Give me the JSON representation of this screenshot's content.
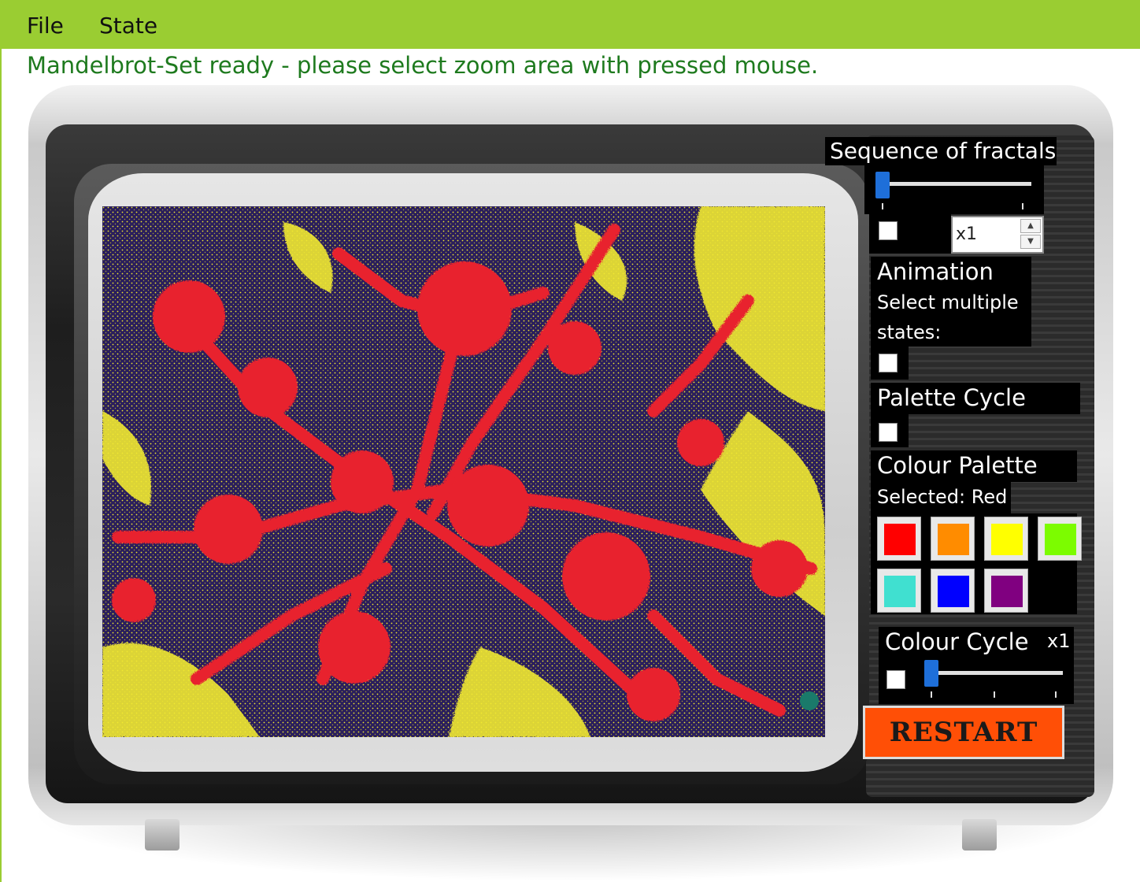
{
  "menu": {
    "file": "File",
    "state": "State"
  },
  "status_text": "Mandelbrot-Set ready - please select zoom area with pressed mouse.",
  "sequence": {
    "title": "Sequence of fractals",
    "slider_value": 0,
    "multiplier": "x1",
    "checked": false
  },
  "spin_icons": {
    "up": "up-arrow-icon",
    "down": "down-arrow-icon"
  },
  "animation": {
    "title": "Animation",
    "line1": "Select multiple",
    "line2": "states:",
    "checked": false
  },
  "palette_cycle": {
    "title": "Palette Cycle",
    "checked": false
  },
  "colour_palette": {
    "title": "Colour Palette",
    "selected_text": "Selected: Red",
    "swatches": [
      {
        "name": "red",
        "color": "#ff0000"
      },
      {
        "name": "orange",
        "color": "#ff8c00"
      },
      {
        "name": "yellow",
        "color": "#ffff00"
      },
      {
        "name": "lime",
        "color": "#7cfc00"
      },
      {
        "name": "turquoise",
        "color": "#40e0d0"
      },
      {
        "name": "blue",
        "color": "#0000ff"
      },
      {
        "name": "purple",
        "color": "#800080"
      }
    ]
  },
  "colour_cycle": {
    "title": "Colour Cycle",
    "multiplier": "x1",
    "slider_value": 0,
    "checked": false
  },
  "restart_label": "RESTART",
  "colors": {
    "menubar": "#9acd32",
    "status_text": "#1e7a1e",
    "fractal_background": "#2a1e5c",
    "fractal_red": "#e8232e",
    "fractal_yellow": "#f0e830",
    "restart": "#ff4f06"
  }
}
